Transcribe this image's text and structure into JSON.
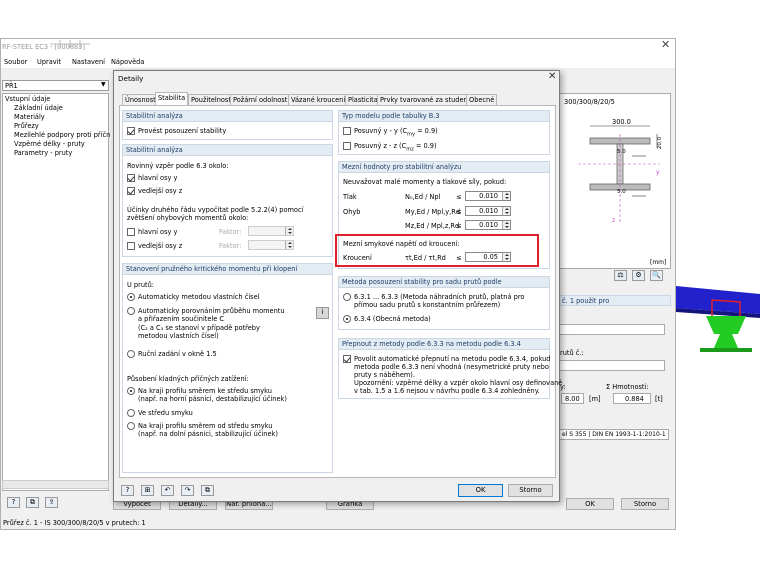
{
  "main": {
    "title": "RF-STEEL EC3 - [000883]",
    "menu": [
      "Soubor",
      "Upravit",
      "Nastavení",
      "Nápověda"
    ],
    "combo": "PŘ1",
    "tree_root": "Vstupní údaje",
    "tree": [
      "Základní údaje",
      "Materiály",
      "Průřezy",
      "Mezilehlé podpory proti příčném",
      "Vzpěrné délky - pruty",
      "Parametry - pruty"
    ],
    "section_label": "300/300/8/20/5",
    "dim_top": "300.0",
    "dim_side": "20.0",
    "dim_web": "5.0",
    "dim_flange": "5.0",
    "unit_mm": "[mm]",
    "right_header": "č. 1 použit pro",
    "right_lbl2": "rutů č.:",
    "right_lbl3": "y:",
    "right_hmot": "Σ Hmotnosti:",
    "right_v1": "8.00",
    "right_u1": "[m]",
    "right_v2": "0.884",
    "right_u2": "[t]",
    "right_mat": "el S 355 | DIN EN 1993-1-1:2010-1",
    "bottom_buttons": [
      "Výpočet",
      "Detaily...",
      "Nár. příloha...",
      "Grafika",
      "OK",
      "Storno"
    ],
    "status": "Průřez č. 1 - IS 300/300/8/20/5 v prutech: 1"
  },
  "dialog": {
    "title": "Detaily",
    "tabs": [
      "Únosnost",
      "Stabilita",
      "Použitelnost",
      "Požární odolnost",
      "Vázané kroucení",
      "Plasticita",
      "Prvky tvarované za studena",
      "Obecné"
    ],
    "g1": {
      "title": "Stabilitní analýza",
      "item": "Provést posouzení stability"
    },
    "g2": {
      "title": "Stabilitní analýza",
      "lbl": "Rovinný vzpěr podle 6.3 okolo:",
      "hlavni": "hlavní osy y",
      "vedlejsi": "vedlejší osy z",
      "desc": "Účinky druhého řádu vypočítat podle 5.2.2(4) pomocí zvětšení ohybových momentů okolo:",
      "hlavni2": "hlavní osy y",
      "vedlejsi2": "vedlejší osy z",
      "faktor": "Faktor:"
    },
    "g3": {
      "title": "Stanovení pružného kritického momentu při klopení",
      "u": "U prutů:",
      "r1": "Automaticky metodou vlastních čísel",
      "r2a": "Automaticky porovnáním průběhu momentu",
      "r2b": "a přiřazením součinitele C",
      "r2c": "(C₂ a C₃ se stanoví v případě potřeby",
      "r2d": "metodou vlastních čísel)",
      "r3": "Ruční zadání v okně 1.5",
      "pus": "Působení kladných příčných zatížení:",
      "p1a": "Na kraji profilu směrem ke středu smyku",
      "p1b": "(např. na horní pásnici, destabilizující účinek)",
      "p2": "Ve středu smyku",
      "p3a": "Na kraji profilu směrem od středu smyku",
      "p3b": "(např. na dolní pásnici, stabilizující účinek)"
    },
    "g4": {
      "title": "Typ modelu podle tabulky B.3",
      "a": "Posuvný y - y (C",
      "a_sub": "my",
      "a_end": " = 0.9)",
      "b": "Posuvný z - z (C",
      "b_sub": "mz",
      "b_end": " = 0.9)"
    },
    "g5": {
      "title": "Mezní hodnoty pro stabilitní analýzu",
      "desc": "Neuvažovat malé momenty a tlakové síly, pokud:",
      "tlak": "Tlak",
      "ohyb": "Ohyb",
      "f1": "N₀,Ed / Npl",
      "f2": "My,Ed / Mpl,y,Rd",
      "f3": "Mz,Ed / Mpl,z,Rd",
      "le": "≤",
      "v1": "0.010",
      "v2": "0.010",
      "v3": "0.010"
    },
    "g6": {
      "title": "Mezní smykové napětí od kroucení:",
      "kr": "Kroucení",
      "f": "τt,Ed / τt,Rd",
      "le": "≤",
      "v": "0.05"
    },
    "g7": {
      "title": "Metoda posouzení stability pro sadu prutů podle",
      "r1a": "6.3.1 ... 6.3.3 (Metoda náhradních prutů, platná pro",
      "r1b": "přímou sadu prutů s konstantním průřezem)",
      "r2": "6.3.4 (Obecná metoda)"
    },
    "g8": {
      "title": "Přepnout z metody podle 6.3.3 na metodu podle 6.3.4",
      "l1": "Povolit automatické přepnutí na metodu podle 6.3.4, pokud",
      "l2": "metoda podle 6.3.3 není vhodná (nesymetrické pruty nebo",
      "l3": "pruty s náběhem).",
      "l4": "Upozornění: vzpěrné délky a vzpěr okolo hlavní osy definované",
      "l5": "v tab. 1.5 a 1.6 nejsou v návrhu podle 6.3.4 zohledněny."
    },
    "ok": "OK",
    "storno": "Storno"
  },
  "colors": {
    "highlight": "#e0202a",
    "group_header": "#e3ebf3",
    "accent": "#1f3f6a",
    "steel_blue": "#2222cc",
    "support_green": "#22cc22"
  }
}
